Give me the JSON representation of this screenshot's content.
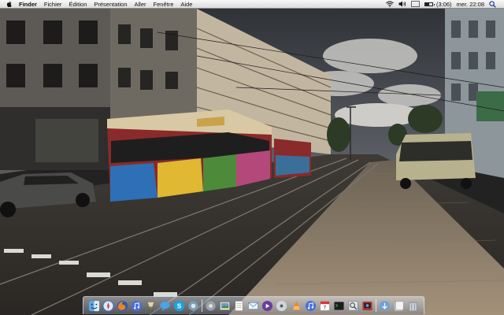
{
  "menubar": {
    "apple": "apple-icon",
    "app_name": "Finder",
    "menus": [
      "Fichier",
      "Édition",
      "Présentation",
      "Aller",
      "Fenêtre",
      "Aide"
    ],
    "status": {
      "battery_text": "(3:06)",
      "battery_level": 0.6,
      "clock": "mer. 22:08",
      "flag_colors": [
        "#0a3d91",
        "#ffffff",
        "#d0202e"
      ],
      "icons": [
        "wifi-icon",
        "volume-icon",
        "flag-icon",
        "battery-icon",
        "spotlight-icon"
      ]
    }
  },
  "desktop": {
    "wallpaper": "Tram on a city street, HDR photo",
    "sky": "#4c5157",
    "ground": "#5e5850",
    "tram_colors": [
      "#8a2a2a",
      "#d8c9a4",
      "#2f6fb6",
      "#e0b832",
      "#4d8a3a"
    ]
  },
  "dock": {
    "items_left": [
      "finder-icon",
      "safari-icon",
      "firefox-icon",
      "itunes-icon",
      "lamp-icon",
      "ichat-icon",
      "skype-icon",
      "app-icon"
    ],
    "items_mid": [
      "system-preferences-icon",
      "iphoto-icon",
      "textedit-icon",
      "mail-icon",
      "imovie-icon",
      "dvd-player-icon",
      "vlc-icon",
      "itunes-icon",
      "calendar-icon",
      "terminal-icon",
      "preview-icon",
      "photo-booth-icon"
    ],
    "items_right": [
      "downloads-icon",
      "documents-stack-icon",
      "trash-icon"
    ]
  }
}
